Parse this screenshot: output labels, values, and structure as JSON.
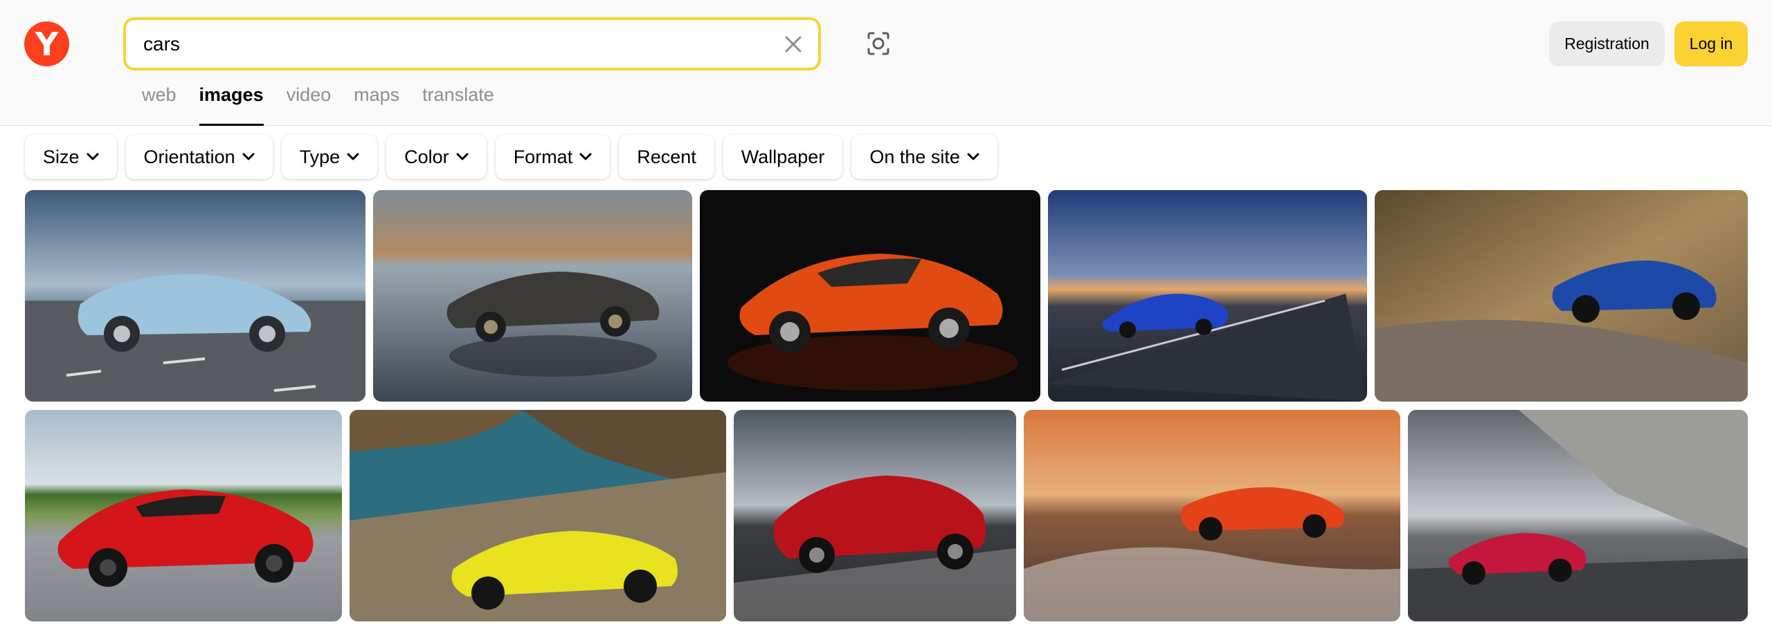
{
  "header": {
    "logo_letter": "Y",
    "search": {
      "value": "cars",
      "placeholder": ""
    },
    "buttons": {
      "registration": "Registration",
      "login": "Log in"
    },
    "tabs": [
      {
        "label": "web",
        "active": false
      },
      {
        "label": "images",
        "active": true
      },
      {
        "label": "video",
        "active": false
      },
      {
        "label": "maps",
        "active": false
      },
      {
        "label": "translate",
        "active": false
      }
    ]
  },
  "filters": [
    {
      "label": "Size",
      "has_dropdown": true
    },
    {
      "label": "Orientation",
      "has_dropdown": true
    },
    {
      "label": "Type",
      "has_dropdown": true
    },
    {
      "label": "Color",
      "has_dropdown": true
    },
    {
      "label": "Format",
      "has_dropdown": true
    },
    {
      "label": "Recent",
      "has_dropdown": false
    },
    {
      "label": "Wallpaper",
      "has_dropdown": false
    },
    {
      "label": "On the site",
      "has_dropdown": true
    }
  ],
  "icons": {
    "clear": "close-icon",
    "camera": "camera-search-icon",
    "dropdown": "chevron-down-icon"
  },
  "colors": {
    "logo": "#fc3f1d",
    "search_border": "#fcd232",
    "login_button": "#fcd232",
    "registration_button": "#ebebeb",
    "inactive_tab": "#8b8e95"
  },
  "results": [
    {
      "subject": "light blue supercar on coastal road",
      "car_color": "#9cc4dd"
    },
    {
      "subject": "dark grey roadster on reflective salt flat",
      "car_color": "#3c3a37"
    },
    {
      "subject": "orange coupe on black background",
      "car_color": "#e04b12"
    },
    {
      "subject": "blue supercar on desert highway at dusk",
      "car_color": "#1f43c6"
    },
    {
      "subject": "blue convertible on mountain road",
      "car_color": "#1d49a8"
    },
    {
      "subject": "red supercar on tarmac",
      "car_color": "#d4161a"
    },
    {
      "subject": "yellow convertible by the sea",
      "car_color": "#e9e21e"
    },
    {
      "subject": "red muscle car under cloudy sky",
      "car_color": "#b8131a"
    },
    {
      "subject": "orange hypercar on track at sunset",
      "car_color": "#e5421a"
    },
    {
      "subject": "red supercar near concrete structure",
      "car_color": "#c5163c"
    }
  ]
}
